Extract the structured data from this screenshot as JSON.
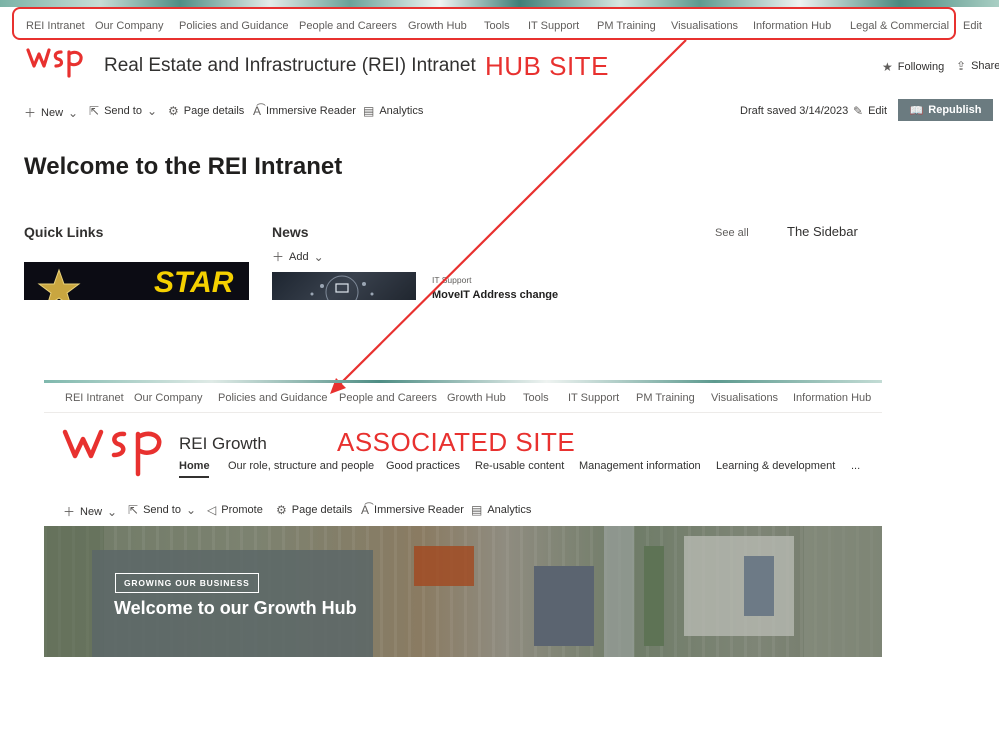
{
  "hub": {
    "nav": [
      "REI Intranet",
      "Our Company",
      "Policies and Guidance",
      "People and Careers",
      "Growth Hub",
      "Tools",
      "IT Support",
      "PM Training",
      "Visualisations",
      "Information Hub",
      "Legal & Commercial"
    ],
    "nav_edit": "Edit",
    "logo_icon": "wsp-logo",
    "site_title": "Real Estate and Infrastructure (REI) Intranet",
    "callout": "HUB SITE",
    "following": "Following",
    "share": "Share",
    "commands": {
      "new": "New",
      "send_to": "Send to",
      "page_details": "Page details",
      "immersive_reader": "Immersive Reader",
      "analytics": "Analytics"
    },
    "draft_status": "Draft saved 3/14/2023",
    "edit": "Edit",
    "republish": "Republish",
    "page_title": "Welcome to the REI Intranet",
    "quick_links_title": "Quick Links",
    "quick_links_image_text": "STAR",
    "news_title": "News",
    "news_add": "Add",
    "news_see_all": "See all",
    "sidebar_title": "The Sidebar",
    "news_item": {
      "category": "IT Support",
      "title": "MoveIT Address change"
    }
  },
  "associated": {
    "nav": [
      "REI Intranet",
      "Our Company",
      "Policies and Guidance",
      "People and Careers",
      "Growth Hub",
      "Tools",
      "IT Support",
      "PM Training",
      "Visualisations",
      "Information Hub"
    ],
    "logo_icon": "wsp-logo",
    "site_title": "REI Growth",
    "callout": "ASSOCIATED SITE",
    "sub_nav": [
      "Home",
      "Our role, structure and people",
      "Good practices",
      "Re-usable content",
      "Management information",
      "Learning & development"
    ],
    "sub_nav_more": "...",
    "commands": {
      "new": "New",
      "send_to": "Send to",
      "promote": "Promote",
      "page_details": "Page details",
      "immersive_reader": "Immersive Reader",
      "analytics": "Analytics"
    },
    "hero_tag": "GROWING OUR BUSINESS",
    "hero_title": "Welcome to our Growth Hub"
  },
  "colors": {
    "annotation_red": "#e8312f",
    "republish_bg": "#6b7b80"
  }
}
